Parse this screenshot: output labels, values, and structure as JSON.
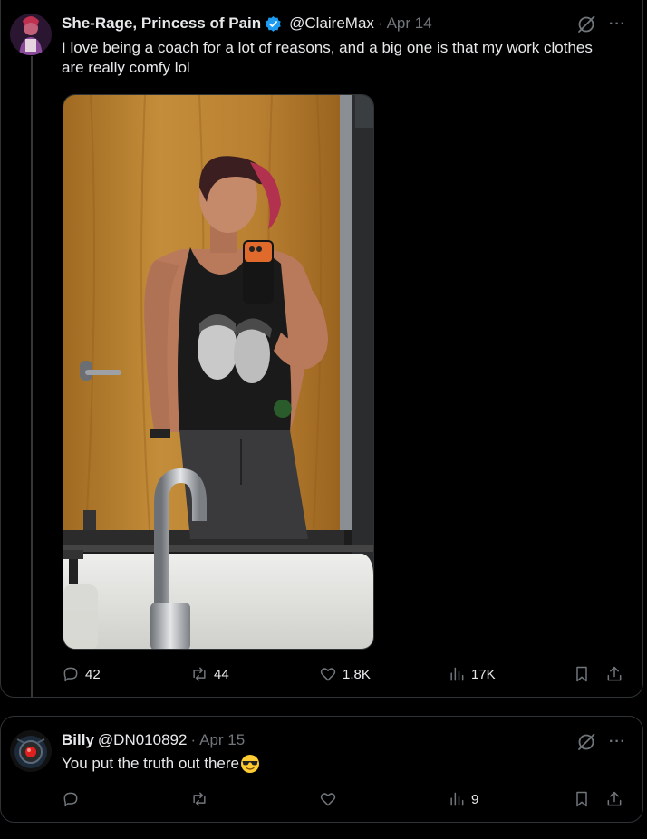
{
  "tweet": {
    "author_name": "She-Rage, Princess of Pain",
    "handle": "@ClaireMax",
    "separator": "·",
    "date": "Apr 14",
    "text": "I love being a coach for a lot of reasons, and a big one is that my work clothes are really comfy lol",
    "verified": true,
    "stats": {
      "replies": "42",
      "reposts": "44",
      "likes": "1.8K",
      "views": "17K"
    }
  },
  "reply": {
    "author_name": "Billy",
    "handle": "@DN010892",
    "separator": "·",
    "date": "Apr 15",
    "text": "You put the truth out there",
    "emoji": "sunglasses-emoji",
    "stats": {
      "replies": "",
      "reposts": "",
      "likes": "",
      "views": "9"
    }
  },
  "icons": {
    "more": "···",
    "verified_color": "#1d9bf0",
    "muted_color": "#71767b"
  }
}
